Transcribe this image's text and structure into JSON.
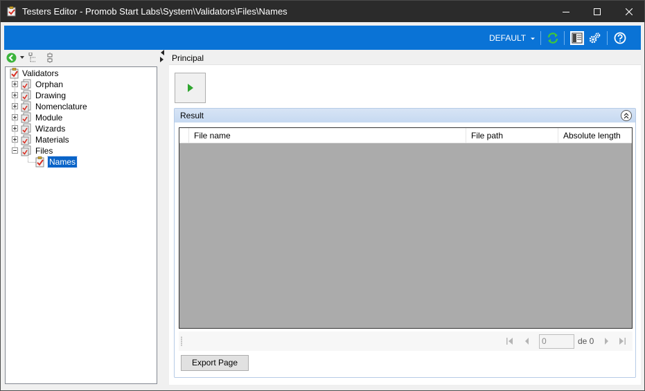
{
  "window": {
    "title": "Testers Editor - Promob Start Labs\\System\\Validators\\Files\\Names",
    "controls": [
      "minimize",
      "maximize",
      "close"
    ]
  },
  "ribbon": {
    "profile_label": "DEFAULT",
    "icons": [
      "refresh-icon",
      "layout-panel-icon",
      "settings-gears-icon",
      "help-icon"
    ],
    "accent_color": "#0a73d6"
  },
  "left_toolbar": {
    "icons": [
      "back-icon",
      "dropdown-arrow-icon",
      "tree-expand-icon",
      "tree-collapse-icon"
    ]
  },
  "tree": {
    "root": "Validators",
    "items": [
      {
        "label": "Orphan",
        "state": "collapsed"
      },
      {
        "label": "Drawing",
        "state": "collapsed"
      },
      {
        "label": "Nomenclature",
        "state": "collapsed"
      },
      {
        "label": "Module",
        "state": "collapsed"
      },
      {
        "label": "Wizards",
        "state": "collapsed"
      },
      {
        "label": "Materials",
        "state": "collapsed"
      },
      {
        "label": "Files",
        "state": "expanded"
      }
    ],
    "child": {
      "label": "Names",
      "selected": true
    }
  },
  "main": {
    "tab_label": "Principal",
    "result_group": {
      "title": "Result",
      "columns": [
        "File name",
        "File path",
        "Absolute length"
      ],
      "rows": []
    },
    "pager": {
      "page_value": "0",
      "of_label": "de 0"
    },
    "export_label": "Export Page"
  }
}
